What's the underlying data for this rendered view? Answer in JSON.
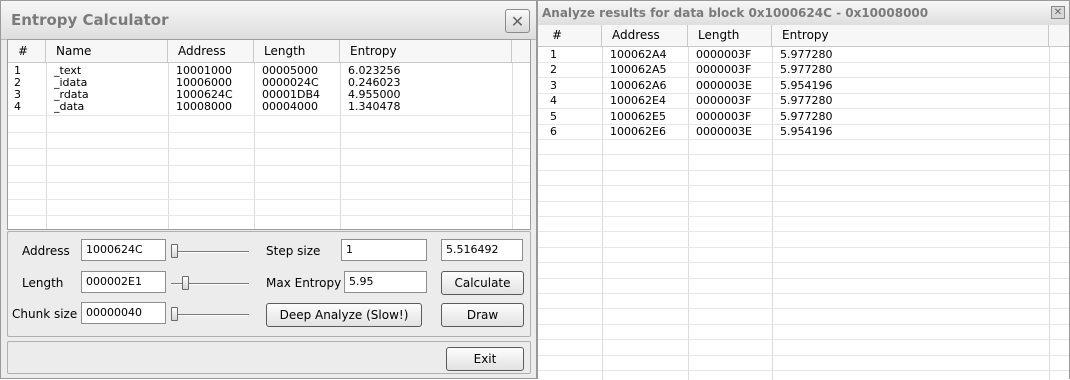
{
  "calc": {
    "title": "Entropy Calculator",
    "columns": [
      "#",
      "Name",
      "Address",
      "Length",
      "Entropy"
    ],
    "rows": [
      [
        "1",
        "_text",
        "10001000",
        "00005000",
        "6.023256"
      ],
      [
        "2",
        "_idata",
        "10006000",
        "0000024C",
        "0.246023"
      ],
      [
        "3",
        "_rdata",
        "1000624C",
        "00001DB4",
        "4.955000"
      ],
      [
        "4",
        "_data",
        "10008000",
        "00004000",
        "1.340478"
      ]
    ],
    "controls": {
      "address_label": "Address",
      "address_value": "1000624C",
      "length_label": "Length",
      "length_value": "000002E1",
      "chunk_label": "Chunk size",
      "chunk_value": "00000040",
      "step_label": "Step size",
      "step_value": "1",
      "max_entropy_label": "Max Entropy",
      "max_entropy_value": "5.95",
      "result_value": "5.516492",
      "calculate_label": "Calculate",
      "draw_label": "Draw",
      "deep_analyze_label": "Deep Analyze (Slow!)",
      "exit_label": "Exit"
    },
    "sliders": {
      "address": 0.0,
      "length": 0.15,
      "chunk": 0.0
    }
  },
  "results": {
    "title": "Analyze results for data block 0x1000624C - 0x10008000",
    "columns": [
      "#",
      "Address",
      "Length",
      "Entropy"
    ],
    "rows": [
      [
        "1",
        "100062A4",
        "0000003F",
        "5.977280"
      ],
      [
        "2",
        "100062A5",
        "0000003F",
        "5.977280"
      ],
      [
        "3",
        "100062A6",
        "0000003E",
        "5.954196"
      ],
      [
        "4",
        "100062E4",
        "0000003F",
        "5.977280"
      ],
      [
        "5",
        "100062E5",
        "0000003F",
        "5.977280"
      ],
      [
        "6",
        "100062E6",
        "0000003E",
        "5.954196"
      ]
    ]
  },
  "icons": {
    "close": "close-icon"
  }
}
